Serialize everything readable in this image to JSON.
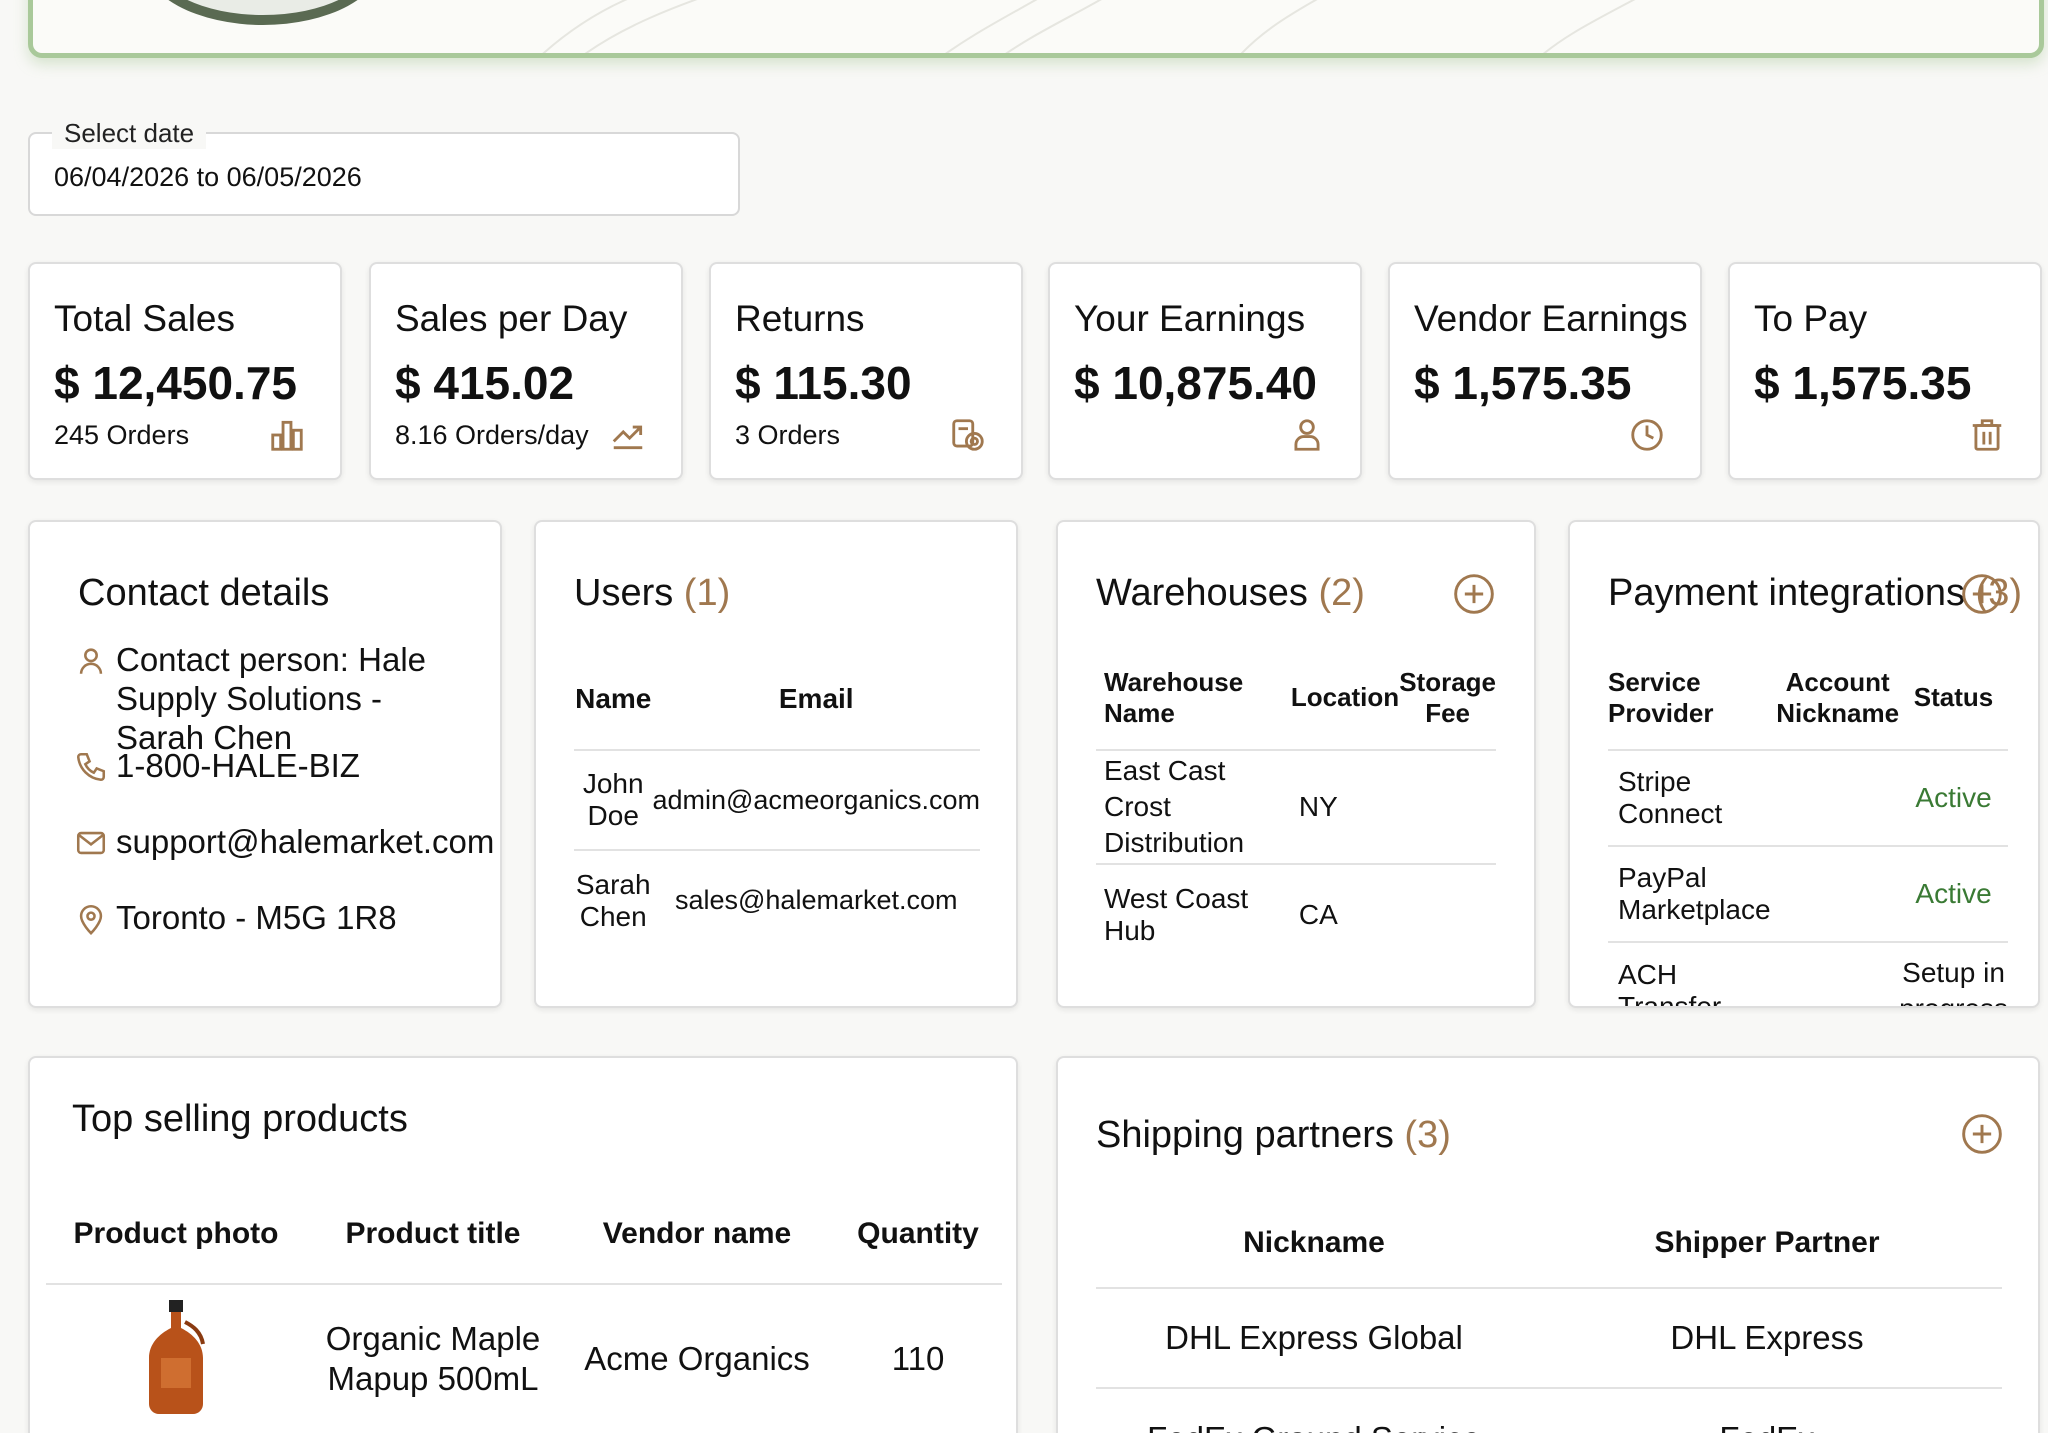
{
  "date": {
    "label": "Select date",
    "value": "06/04/2026 to 06/05/2026"
  },
  "stats": [
    {
      "title": "Total Sales",
      "value": "$ 12,450.75",
      "sub": "245 Orders",
      "icon": "bar-chart-icon"
    },
    {
      "title": "Sales per Day",
      "value": "$ 415.02",
      "sub": "8.16 Orders/day",
      "icon": "trend-up-icon"
    },
    {
      "title": "Returns",
      "value": "$ 115.30",
      "sub": "3 Orders",
      "icon": "returns-icon"
    },
    {
      "title": "Your Earnings",
      "value": "$ 10,875.40",
      "sub": "",
      "icon": "user-icon"
    },
    {
      "title": "Vendor Earnings",
      "value": "$ 1,575.35",
      "sub": "",
      "icon": "clock-icon"
    },
    {
      "title": "To Pay",
      "value": "$ 1,575.35",
      "sub": "",
      "icon": "trash-icon"
    }
  ],
  "contact": {
    "title": "Contact details",
    "person": "Contact person: Hale Supply Solutions - Sarah Chen",
    "phone": "1-800-HALE-BIZ",
    "email": "support@halemarket.com",
    "location": "Toronto - M5G 1R8"
  },
  "users": {
    "title": "Users",
    "count": "(1)",
    "columns": [
      "Name",
      "Email"
    ],
    "rows": [
      {
        "name": "John Doe",
        "email": "admin@acmeorganics.com"
      },
      {
        "name": "Sarah Chen",
        "email": "sales@halemarket.com"
      }
    ]
  },
  "warehouses": {
    "title": "Warehouses",
    "count": "(2)",
    "columns": [
      "Warehouse Name",
      "Location",
      "Storage Fee"
    ],
    "rows": [
      {
        "name": "East Cast Crost Distribution",
        "location": "NY",
        "fee": ""
      },
      {
        "name": "West Coast Hub",
        "location": "CA",
        "fee": ""
      }
    ]
  },
  "payments": {
    "title": "Payment integrations",
    "count": "(3)",
    "columns": [
      "Service Provider",
      "Account Nickname",
      "Status"
    ],
    "rows": [
      {
        "provider": "Stripe Connect",
        "nickname": "",
        "status": "Active"
      },
      {
        "provider": "PayPal Marketplace",
        "nickname": "",
        "status": "Active"
      },
      {
        "provider": "ACH Transfer",
        "nickname": "",
        "status": "Setup in progress"
      }
    ]
  },
  "top_products": {
    "title": "Top selling products",
    "columns": [
      "Product photo",
      "Product title",
      "Vendor name",
      "Quantity"
    ],
    "rows": [
      {
        "photo": "maple-syrup-bottle",
        "title": "Organic Maple Mapup 500mL",
        "vendor": "Acme Organics",
        "quantity": "110"
      }
    ]
  },
  "shipping": {
    "title": "Shipping partners",
    "count": "(3)",
    "columns": [
      "Nickname",
      "Shipper Partner"
    ],
    "rows": [
      {
        "nickname": "DHL Express Global",
        "partner": "DHL Express"
      },
      {
        "nickname": "FedEx Ground Service",
        "partner": "FedEx"
      }
    ]
  },
  "colors": {
    "accent": "#a0784f",
    "active": "#3a7a34",
    "banner_border": "#a9c99a"
  }
}
